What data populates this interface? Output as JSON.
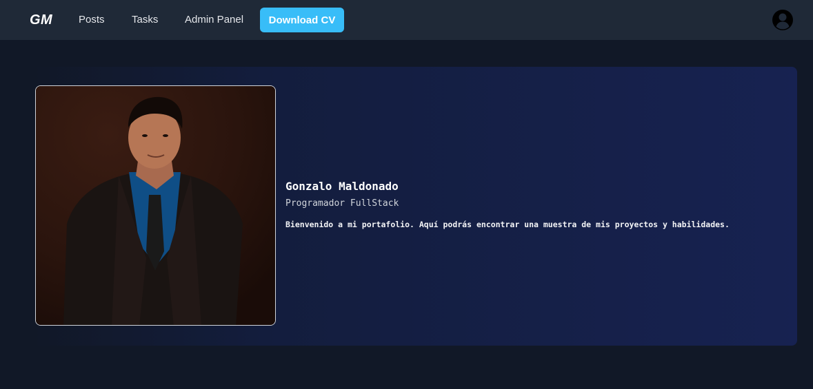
{
  "navbar": {
    "logo": "GM",
    "links": [
      "Posts",
      "Tasks",
      "Admin Panel"
    ],
    "cv_button": "Download CV",
    "user_icon": "user-circle-icon"
  },
  "hero": {
    "name": "Gonzalo Maldonado",
    "role": "Programador FullStack",
    "welcome": "Bienvenido a mi portafolio. Aquí podrás encontrar una muestra de mis proyectos y habilidades."
  },
  "colors": {
    "background": "#111827",
    "navbar": "#1f2937",
    "accent": "#38bdf8",
    "hero_gradient_end": "#172251"
  }
}
